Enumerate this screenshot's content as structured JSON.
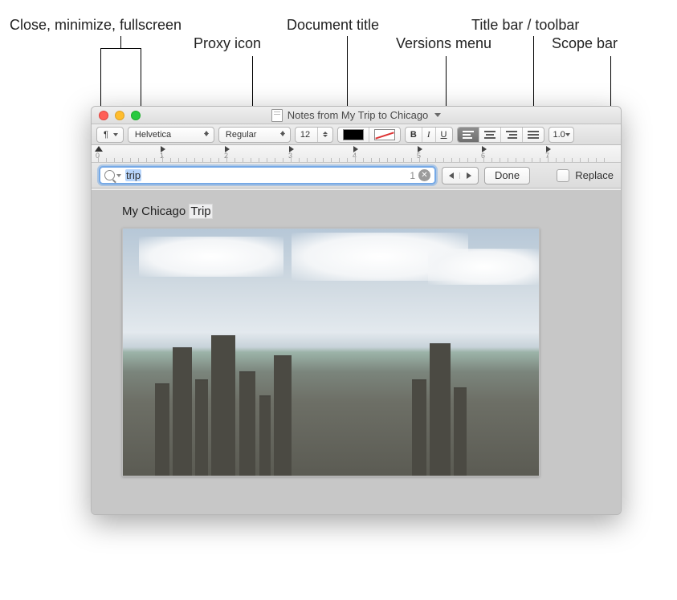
{
  "annotations": {
    "close_min_full": "Close, minimize, fullscreen",
    "proxy_icon": "Proxy icon",
    "doc_title": "Document title",
    "versions_menu": "Versions menu",
    "titlebar_toolbar": "Title bar / toolbar",
    "scope_bar": "Scope bar"
  },
  "titlebar": {
    "document_title": "Notes from My Trip to Chicago"
  },
  "toolbar": {
    "para_symbol": "¶",
    "font_family": "Helvetica",
    "font_style": "Regular",
    "font_size": "12",
    "bold": "B",
    "italic": "I",
    "underline": "U",
    "line_spacing": "1.0"
  },
  "ruler": {
    "tick_numbers": [
      "0",
      "1",
      "2",
      "3",
      "4",
      "5",
      "6",
      "7"
    ]
  },
  "scopebar": {
    "search_value": "trip",
    "match_count": "1",
    "done_label": "Done",
    "replace_label": "Replace"
  },
  "document": {
    "line_prefix": "My Chicago ",
    "line_highlight": "Trip"
  }
}
